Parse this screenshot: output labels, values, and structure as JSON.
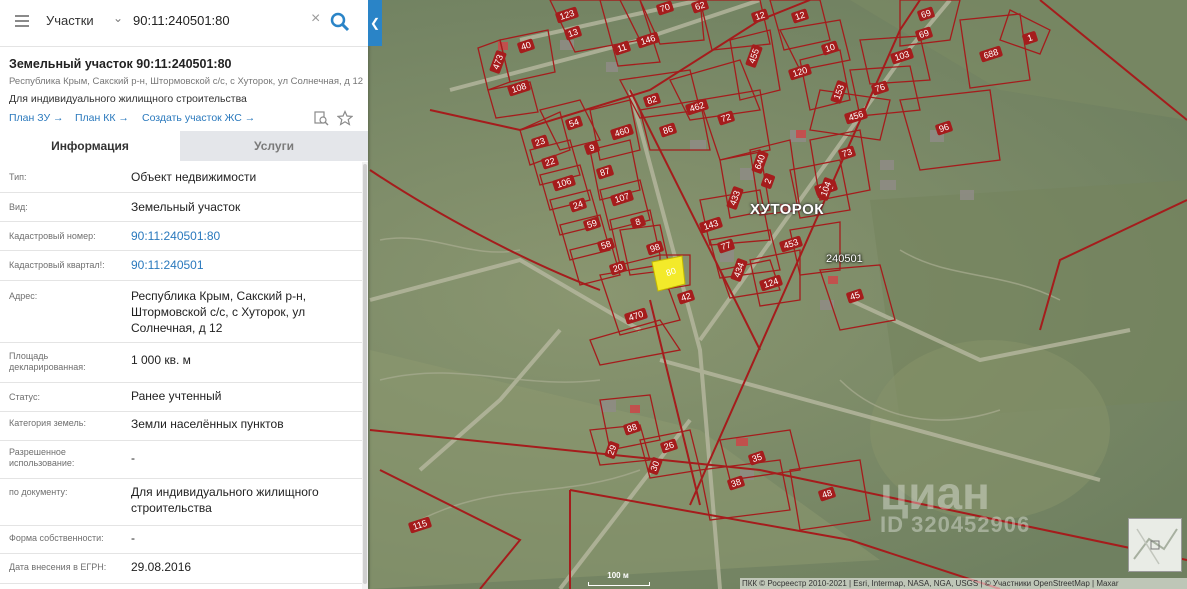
{
  "search": {
    "layer": "Участки",
    "query": "90:11:240501:80"
  },
  "header": {
    "title": "Земельный участок 90:11:240501:80",
    "address_short": "Республика Крым, Сакский р-н, Штормовской с/с, с Хуторок, ул Солнечная, д 12",
    "purpose": "Для индивидуального жилищного строительства"
  },
  "links": [
    "План ЗУ",
    "План КК",
    "Создать участок ЖС"
  ],
  "tabs": {
    "info": "Информация",
    "services": "Услуги"
  },
  "info_rows": [
    {
      "label": "Тип:",
      "value": "Объект недвижимости"
    },
    {
      "label": "Вид:",
      "value": "Земельный участок"
    },
    {
      "label": "Кадастровый номер:",
      "value": "90:11:240501:80"
    },
    {
      "label": "Кадастровый квартал!:",
      "value": "90:11:240501"
    },
    {
      "label": "Адрес:",
      "value": "Республика Крым, Сакский р-н, Штормовской с/с, с Хуторок, ул Солнечная, д 12"
    },
    {
      "label": "Площадь декларированная:",
      "value": "1 000 кв. м"
    },
    {
      "label": "Статус:",
      "value": "Ранее учтенный"
    },
    {
      "label": "Категория земель:",
      "value": "Земли населённых пунктов"
    },
    {
      "label": "Разрешенное использование:",
      "value": "-"
    },
    {
      "label": "по документу:",
      "value": "Для индивидуального жилищного строительства"
    },
    {
      "label": "Форма собственности:",
      "value": "-"
    },
    {
      "label": "Дата внесения в ЕГРН:",
      "value": "29.08.2016"
    }
  ],
  "map": {
    "place_name": "ХУТОРОК",
    "quarter": "240501",
    "plot_labels": [
      "123",
      "13",
      "70",
      "62",
      "12",
      "12",
      "10",
      "69",
      "69",
      "688",
      "1",
      "40",
      "473",
      "108",
      "11",
      "146",
      "120",
      "104",
      "103",
      "76",
      "455",
      "82",
      "462",
      "86",
      "72",
      "456",
      "96",
      "23",
      "54",
      "460",
      "9",
      "22",
      "87",
      "106",
      "107",
      "24",
      "59",
      "8",
      "58",
      "98",
      "20",
      "80",
      "42",
      "470",
      "153",
      "73",
      "640",
      "433",
      "2",
      "104",
      "143",
      "77",
      "434",
      "124",
      "453",
      "45",
      "88",
      "26",
      "29",
      "30",
      "35",
      "38",
      "48",
      "115"
    ],
    "scale": "100 м",
    "attribution": "ПКК © Росреестр 2010-2021 | Esri, Intermap, NASA, NGA, USGS | © Участники OpenStreetMap | Maxar",
    "watermark_text": "циан",
    "watermark_id": "ID 320452906",
    "selected_color": "#f3ea2a",
    "boundary_color": "#a51c1c"
  }
}
